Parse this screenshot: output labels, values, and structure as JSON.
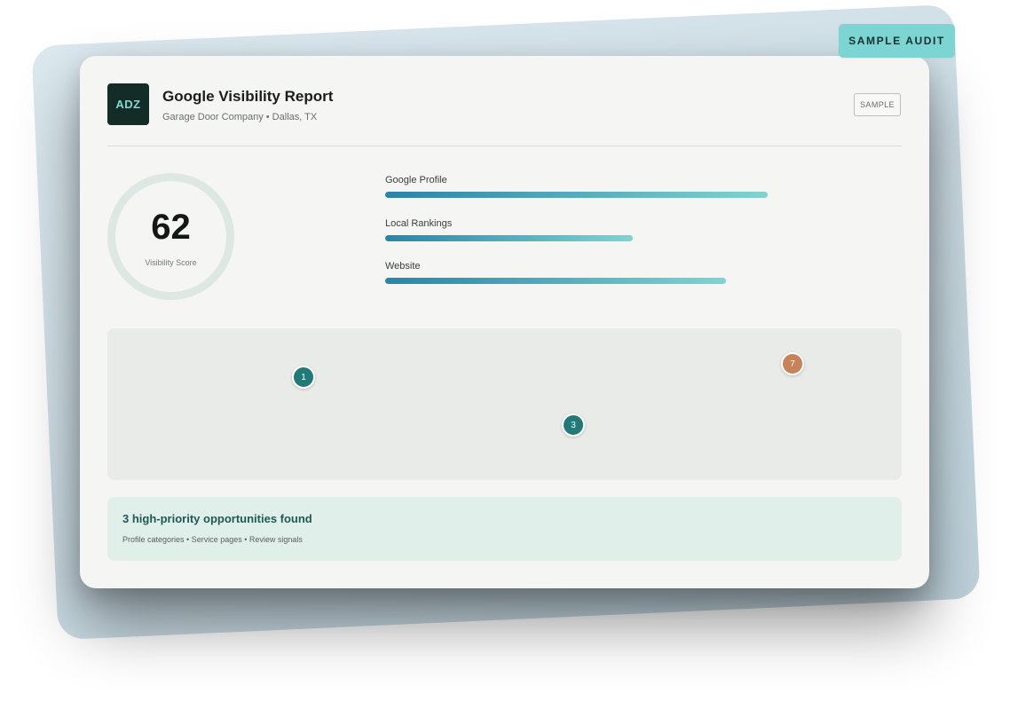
{
  "tag": {
    "label": "SAMPLE AUDIT"
  },
  "report": {
    "logo_text": "ADZ",
    "title": "Google Visibility Report",
    "subtitle": "Garage Door Company • Dallas, TX",
    "sample_button": "SAMPLE"
  },
  "score": {
    "value": "62",
    "label": "Visibility Score"
  },
  "metrics": [
    {
      "label": "Google Profile",
      "fraction": 0.98
    },
    {
      "label": "Local Rankings",
      "fraction": 0.635
    },
    {
      "label": "Website",
      "fraction": 0.873
    }
  ],
  "map": {
    "pins": [
      {
        "label": "1",
        "color": "#1f7a78"
      },
      {
        "label": "3",
        "color": "#1f7a78"
      },
      {
        "label": "7",
        "color": "#c98158"
      }
    ]
  },
  "summary": {
    "title": "3 high-priority opportunities found",
    "details": "Profile categories • Service pages • Review signals"
  },
  "colors": {
    "accent_teal": "#7dd5d3",
    "dark_brand": "#142c28",
    "bar_start": "#2a84a6",
    "bar_end": "#7fd4d2"
  }
}
